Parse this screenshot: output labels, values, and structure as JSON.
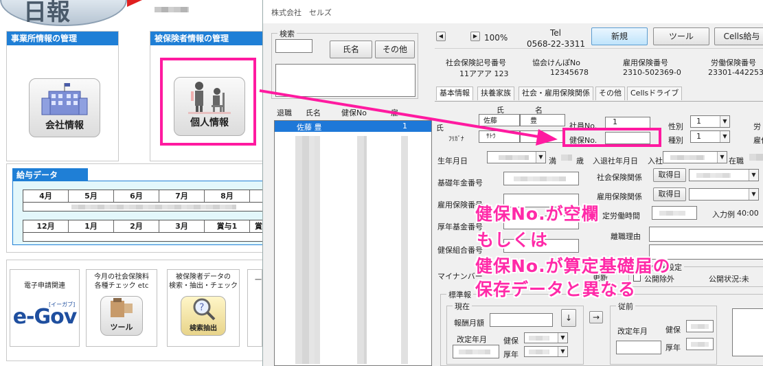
{
  "left_app": {
    "logo_text": "日報",
    "section_office": "事業所情報の管理",
    "section_insured": "被保険者情報の管理",
    "company_btn": "会社情報",
    "personal_btn": "個人情報",
    "kyuyo_header": "給与データ",
    "months_row1": [
      "4月",
      "5月",
      "6月",
      "7月",
      "8月"
    ],
    "months_row2": [
      "12月",
      "1月",
      "2月",
      "3月",
      "賞与1",
      "賞"
    ],
    "card_egov_title": "電子申請関連",
    "card_egov_logo": "e-Gov",
    "card_egov_sub": "[イーガブ]",
    "card_check_title": "今月の社会保険料\n各種チェック etc",
    "card_check_btn": "ツール",
    "card_search_title": "被保険者データの\n検索・抽出・チェック",
    "card_search_btn": "検索抽出",
    "card_partial": "一"
  },
  "window": {
    "title": "株式会社　セルズ",
    "search_group": "検索",
    "btn_name": "氏名",
    "btn_other": "その他",
    "list_headers": [
      "退職",
      "氏名",
      "健保No",
      "雇"
    ],
    "list_first_row": {
      "name": "佐藤 豊",
      "no": "1"
    },
    "zoom": "100%",
    "tel_label": "Tel",
    "tel_value": "0568-22-3311",
    "btn_new": "新規",
    "btn_tool": "ツール",
    "btn_cells": "Cells給与",
    "codes": [
      {
        "label": "社会保険記号番号",
        "value": "11アアア 123"
      },
      {
        "label": "協会けんぽNo",
        "value": "12345678"
      },
      {
        "label": "雇用保険番号",
        "value": "2310-502369-0"
      },
      {
        "label": "労働保険番号",
        "value": "23301-442253"
      }
    ],
    "tabs": [
      "基本情報",
      "扶養家族",
      "社会・雇用保険関係",
      "その他",
      "Cellsドライブ"
    ],
    "lbl_shi": "氏",
    "lbl_mei": "名",
    "sei_value": "佐藤",
    "mei_value": "豊",
    "lbl_furigana": "ﾌﾘｶﾞﾅ",
    "furigana_value": "ｻﾄｳ",
    "lbl_shain_no": "社員No.",
    "shain_no_value": "1",
    "lbl_kenpo_no": "健保No.",
    "lbl_seibetsu": "性別",
    "seibetsu_value": "1",
    "lbl_shubetsu": "種別",
    "shubetsu_value": "1",
    "lbl_rou": "労",
    "lbl_yato": "雇作",
    "lbl_seinen": "生年月日",
    "lbl_man": "満",
    "lbl_sai": "歳",
    "lbl_nyutai": "入退社年月日",
    "lbl_nyusha": "入社",
    "lbl_zaishoku": "在職",
    "lbl_kiso": "基礎年金番号",
    "lbl_shaho": "社会保険関係",
    "lbl_koyo": "雇用保険関係",
    "btn_shutoku1": "取得日",
    "btn_shutoku2": "取得日",
    "lbl_koyo_no": "雇用保険番号",
    "lbl_kousei": "厚年基金番号",
    "lbl_teitei": "定労働時間",
    "lbl_nyuryoku": "入力例",
    "nyuryoku_value": "40:00",
    "lbl_kenpo_kumiai": "健保組合番号",
    "lbl_rishoku": "離職理由",
    "lbl_mynumber": "マイナンバー",
    "lbl_kojin": "個人情報設定",
    "lbl_koukai_jogai": "公開除外",
    "lbl_koukai_status": "公開状況:未",
    "lbl_koshin": "更新",
    "lbl_hyojun": "標準報",
    "lbl_genzai": "現在",
    "lbl_hoshu": "報酬月額",
    "lbl_kaitei": "改定年月",
    "lbl_kenpo": "健保",
    "lbl_kounen": "厚年",
    "lbl_juzen": "従前",
    "lbl_kaitei2": "改定年月",
    "lbl_kenpo2": "健保",
    "lbl_kounen2": "厚年",
    "down_arrow": "↓",
    "right_arrow": "→"
  },
  "annotation": {
    "line1": "健保No.が空欄",
    "line2": "もしくは",
    "line3": "健保No.が算定基礎届の",
    "line4": "保存データと異なる"
  }
}
